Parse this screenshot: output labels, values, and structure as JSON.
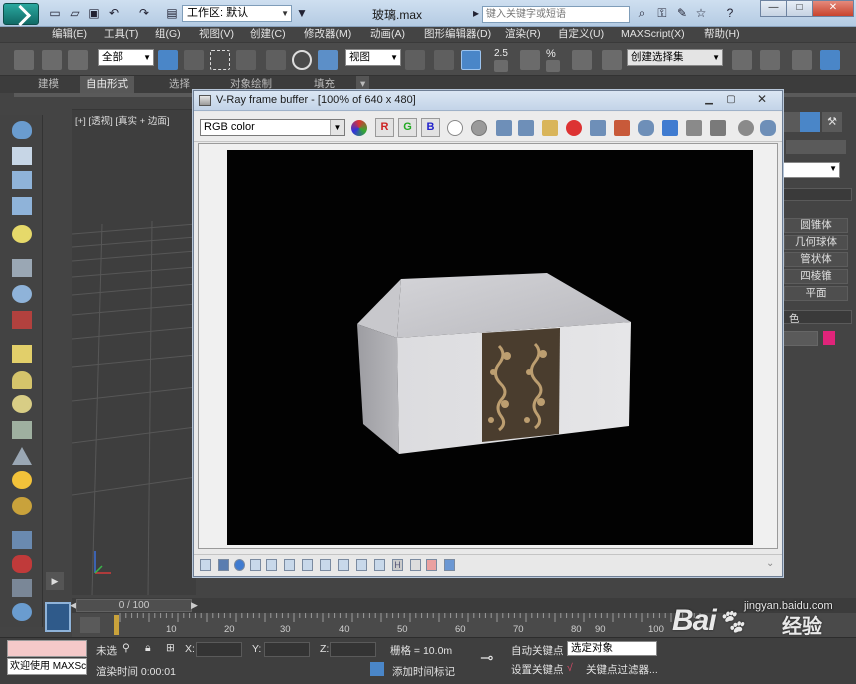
{
  "titlebar": {
    "workspace": "工作区: 默认",
    "file_title": "玻璃.max",
    "search_placeholder": "键入关键字或短语"
  },
  "menu": [
    "编辑(E)",
    "工具(T)",
    "组(G)",
    "视图(V)",
    "创建(C)",
    "修改器(M)",
    "动画(A)",
    "图形编辑器(D)",
    "渲染(R)",
    "自定义(U)",
    "MAXScript(X)",
    "帮助(H)"
  ],
  "toolbar": {
    "selection_filter": "全部",
    "reference_coord": "视图",
    "angle_snap_value": "2.5",
    "percent_snap_label": "%",
    "named_selection": "创建选择集"
  },
  "ribbon": {
    "tabs": [
      "建模",
      "自由形式",
      "选择",
      "对象绘制",
      "填充"
    ],
    "active_tab": "自由形式"
  },
  "viewport": {
    "label": "[+] [透视] [真实 + 边面]"
  },
  "vfb": {
    "title": "V-Ray frame buffer - [100% of 640 x 480]",
    "channel": "RGB color",
    "r_label": "R",
    "g_label": "G",
    "b_label": "B"
  },
  "right_panel": {
    "buttons": [
      "圆锥体",
      "几何球体",
      "管状体",
      "四棱锥",
      "平面"
    ],
    "color_label": "色",
    "accent_color": "#e0247a"
  },
  "timeline": {
    "slider_label": "0 / 100",
    "ruler_numbers": [
      "10",
      "20",
      "30",
      "40",
      "50",
      "60",
      "70",
      "80",
      "90",
      "100"
    ]
  },
  "status": {
    "welcome": "欢迎使用 MAXSc",
    "selection": "未选",
    "x_label": "X:",
    "y_label": "Y:",
    "z_label": "Z:",
    "grid": "栅格 = 10.0m",
    "auto_key": "自动关键点",
    "set_key": "设置关键点",
    "selected_object": "选定对象",
    "key_filters": "关键点过滤器...",
    "render_time": "渲染时间 0:00:01",
    "add_time_tag": "添加时间标记"
  },
  "watermark": {
    "brand": "Bai",
    "brand_cn": "经验",
    "url": "jingyan.baidu.com"
  }
}
